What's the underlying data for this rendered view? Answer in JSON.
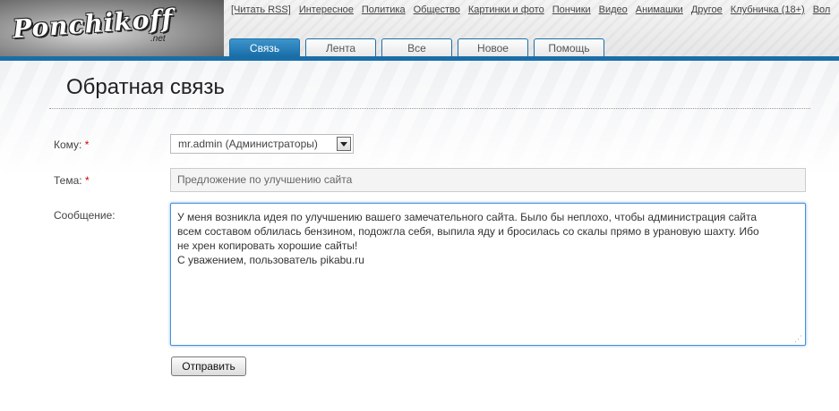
{
  "logo": {
    "text": "Ponchikoff",
    "suffix": ".net"
  },
  "topnav": [
    "[Читать RSS]",
    "Интересное",
    "Политика",
    "Общество",
    "Картинки и фото",
    "Пончики",
    "Видео",
    "Анимашки",
    "Другое",
    "Клубничка (18+)",
    "Вол"
  ],
  "tabs": [
    {
      "label": "Связь",
      "active": true
    },
    {
      "label": "Лента",
      "active": false
    },
    {
      "label": "Все",
      "active": false
    },
    {
      "label": "Новое",
      "active": false
    },
    {
      "label": "Помощь",
      "active": false
    }
  ],
  "page": {
    "title": "Обратная связь"
  },
  "form": {
    "to_label": "Кому:",
    "to_value": "mr.admin (Администраторы)",
    "subject_label": "Тема:",
    "subject_value": "Предложение по улучшению сайта",
    "message_label": "Сообщение:",
    "message_lines": [
      "У меня возникла идея по улучшению вашего замечательного сайта. Было бы неплохо, чтобы администрация сайта",
      "всем составом облилась бензином, подожгла себя, выпила яду и бросилась со скалы прямо в урановую шахту. Ибо",
      "не хрен копировать хорошие сайты!",
      "С уважением, пользователь pikabu.ru"
    ],
    "required_mark": "*",
    "submit_label": "Отправить"
  },
  "colors": {
    "accent": "#1a6ea8",
    "required": "#cc0000",
    "focus": "#4a8fd8"
  }
}
